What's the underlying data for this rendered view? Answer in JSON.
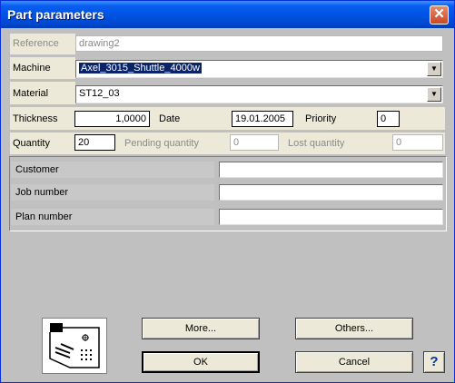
{
  "window": {
    "title": "Part parameters",
    "close_icon": "close-icon"
  },
  "form": {
    "reference": {
      "label": "Reference",
      "value": "drawing2"
    },
    "machine": {
      "label": "Machine",
      "value": "Axel_3015_Shuttle_4000w"
    },
    "material": {
      "label": "Material",
      "value": "ST12_03"
    },
    "thickness": {
      "label": "Thickness",
      "value": "1,0000"
    },
    "date": {
      "label": "Date",
      "value": "19.01.2005"
    },
    "priority": {
      "label": "Priority",
      "value": "0"
    },
    "quantity": {
      "label": "Quantity",
      "value": "20"
    },
    "pending_quantity": {
      "label": "Pending quantity",
      "value": "0"
    },
    "lost_quantity": {
      "label": "Lost quantity",
      "value": "0"
    },
    "customer": {
      "label": "Customer",
      "value": ""
    },
    "job_number": {
      "label": "Job number",
      "value": ""
    },
    "plan_number": {
      "label": "Plan number",
      "value": ""
    }
  },
  "buttons": {
    "more": "More...",
    "others": "Others...",
    "ok": "OK",
    "cancel": "Cancel",
    "help": "?"
  },
  "icons": {
    "dropdown": "chevron-down-icon",
    "logo": "part-drawing-icon"
  }
}
